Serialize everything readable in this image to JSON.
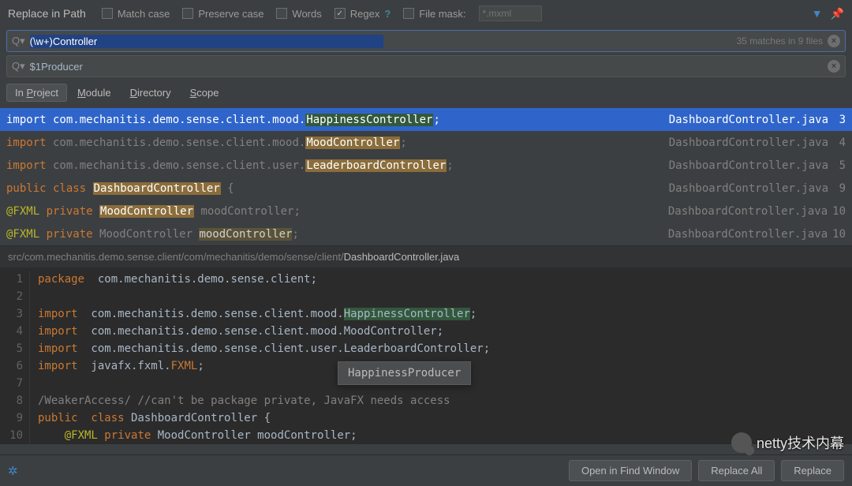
{
  "title": "Replace in Path",
  "options": {
    "match_case": "Match case",
    "preserve_case": "Preserve case",
    "words": "Words",
    "regex": "Regex",
    "regex_help": "?",
    "file_mask": "File mask:",
    "file_mask_placeholder": "*.mxml"
  },
  "search": {
    "value": "(\\w+)Controller",
    "match_count": "35 matches in 9 files"
  },
  "replace": {
    "value": "$1Producer"
  },
  "tabs": {
    "in_project": "In Project",
    "module": "Module",
    "directory": "Directory",
    "scope": "Scope"
  },
  "results": [
    {
      "prefix_kw": "import",
      "prefix": " com.mechanitis.demo.sense.client.mood.",
      "hl": "HappinessController",
      "suffix": ";",
      "file": "DashboardController.java",
      "line": "3",
      "selected": true
    },
    {
      "prefix_kw": "import",
      "prefix": " com.mechanitis.demo.sense.client.mood.",
      "hl": "MoodController",
      "suffix": ";",
      "file": "DashboardController.java",
      "line": "4",
      "selected": false
    },
    {
      "prefix_kw": "import",
      "prefix": " com.mechanitis.demo.sense.client.user.",
      "hl": "LeaderboardController",
      "suffix": ";",
      "file": "DashboardController.java",
      "line": "5",
      "selected": false
    },
    {
      "prefix_kw": "public class ",
      "prefix": "",
      "hl": "DashboardController",
      "suffix": " {",
      "file": "DashboardController.java",
      "line": "9",
      "selected": false
    },
    {
      "ann": "@FXML",
      "prefix_kw2": " private ",
      "hl": "MoodController",
      "suffix": " moodController;",
      "file": "DashboardController.java",
      "line": "10",
      "selected": false
    },
    {
      "ann": "@FXML",
      "prefix_kw2": " private ",
      "plain": "MoodController ",
      "hl2": "moodController",
      "suffix": ";",
      "file": "DashboardController.java",
      "line": "10",
      "selected": false
    }
  ],
  "filepath": {
    "dir": "src/com.mechanitis.demo.sense.client/com/mechanitis/demo/sense/client/",
    "file": "DashboardController.java"
  },
  "code": {
    "lines": [
      "1",
      "2",
      "3",
      "4",
      "5",
      "6",
      "7",
      "8",
      "9",
      "10"
    ],
    "l1_kw": "package",
    "l1_rest": "  com.mechanitis.demo.sense.client;",
    "l3_kw": "import",
    "l3_rest": "  com.mechanitis.demo.sense.client.mood.",
    "l3_hl": "HappinessController",
    "l3_semi": ";",
    "l4_kw": "import",
    "l4_rest": "  com.mechanitis.demo.sense.client.mood.MoodController;",
    "l5_kw": "import",
    "l5_rest": "  com.mechanitis.demo.sense.client.user.LeaderboardController;",
    "l6_kw": "import",
    "l6_rest": "  javafx.fxml.",
    "l6_c": "FXML",
    "l6_semi": ";",
    "l8_cmt1": "/WeakerAccess/",
    "l8_cmt2": " //can't be package private, JavaFX needs access",
    "l9_kw": "public  class",
    "l9_rest": " DashboardController {",
    "l10_ann": "@FXML",
    "l10_kw": " private",
    "l10_rest": " MoodController moodController;"
  },
  "tooltip": "HappinessProducer",
  "footer": {
    "open": "Open in Find Window",
    "replace_all": "Replace All",
    "replace": "Replace"
  },
  "watermark": "netty技术内幕"
}
